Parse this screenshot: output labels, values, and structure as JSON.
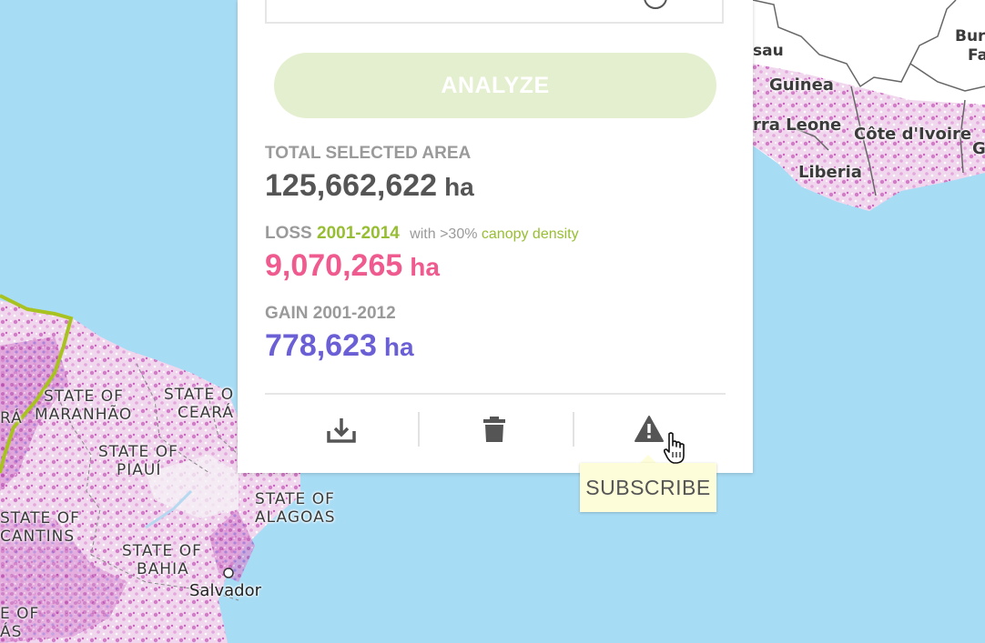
{
  "map": {
    "labels": {
      "bissau": "sau",
      "burkina_1": "Bur",
      "burkina_2": "Fa",
      "guinea": "Guinea",
      "sierra_leone": "rra Leone",
      "cote_divoire": "Côte d'Ivoire",
      "ghana": "G",
      "liberia": "Liberia",
      "maranhao_1": "STATE OF",
      "maranhao_2": "MARANHÃO",
      "para": "RÁ",
      "ceara_1": "STATE O",
      "ceara_2": "CEARÁ",
      "piaui_1": "STATE OF",
      "piaui_2": "PIAUÍ",
      "alagoas_1": "STATE OF",
      "alagoas_2": "ALAGOAS",
      "tocantins_1": "STATE OF",
      "tocantins_2": "CANTINS",
      "bahia_1": "STATE OF",
      "bahia_2": "BAHIA",
      "salvador": "Salvador",
      "goias_1": "E OF",
      "goias_2": "ÁS"
    }
  },
  "panel": {
    "analyze_label": "ANALYZE",
    "total": {
      "label": "TOTAL SELECTED AREA",
      "value": "125,662,622",
      "unit": "ha"
    },
    "loss": {
      "label": "LOSS",
      "years": "2001-2014",
      "note_prefix": "with >30%",
      "note_link": "canopy density",
      "value": "9,070,265",
      "unit": "ha"
    },
    "gain": {
      "label": "GAIN 2001-2012",
      "value": "778,623",
      "unit": "ha"
    },
    "tools": [
      {
        "icon": "download-icon"
      },
      {
        "icon": "trash-icon"
      },
      {
        "icon": "alert-icon"
      }
    ],
    "tooltip": "SUBSCRIBE"
  },
  "colors": {
    "ocean": "#a7dcf5",
    "loss": "#ef5b8f",
    "gain": "#6b5fd6",
    "accent_green": "#97be32",
    "analyze_disabled": "#e4efcf"
  }
}
